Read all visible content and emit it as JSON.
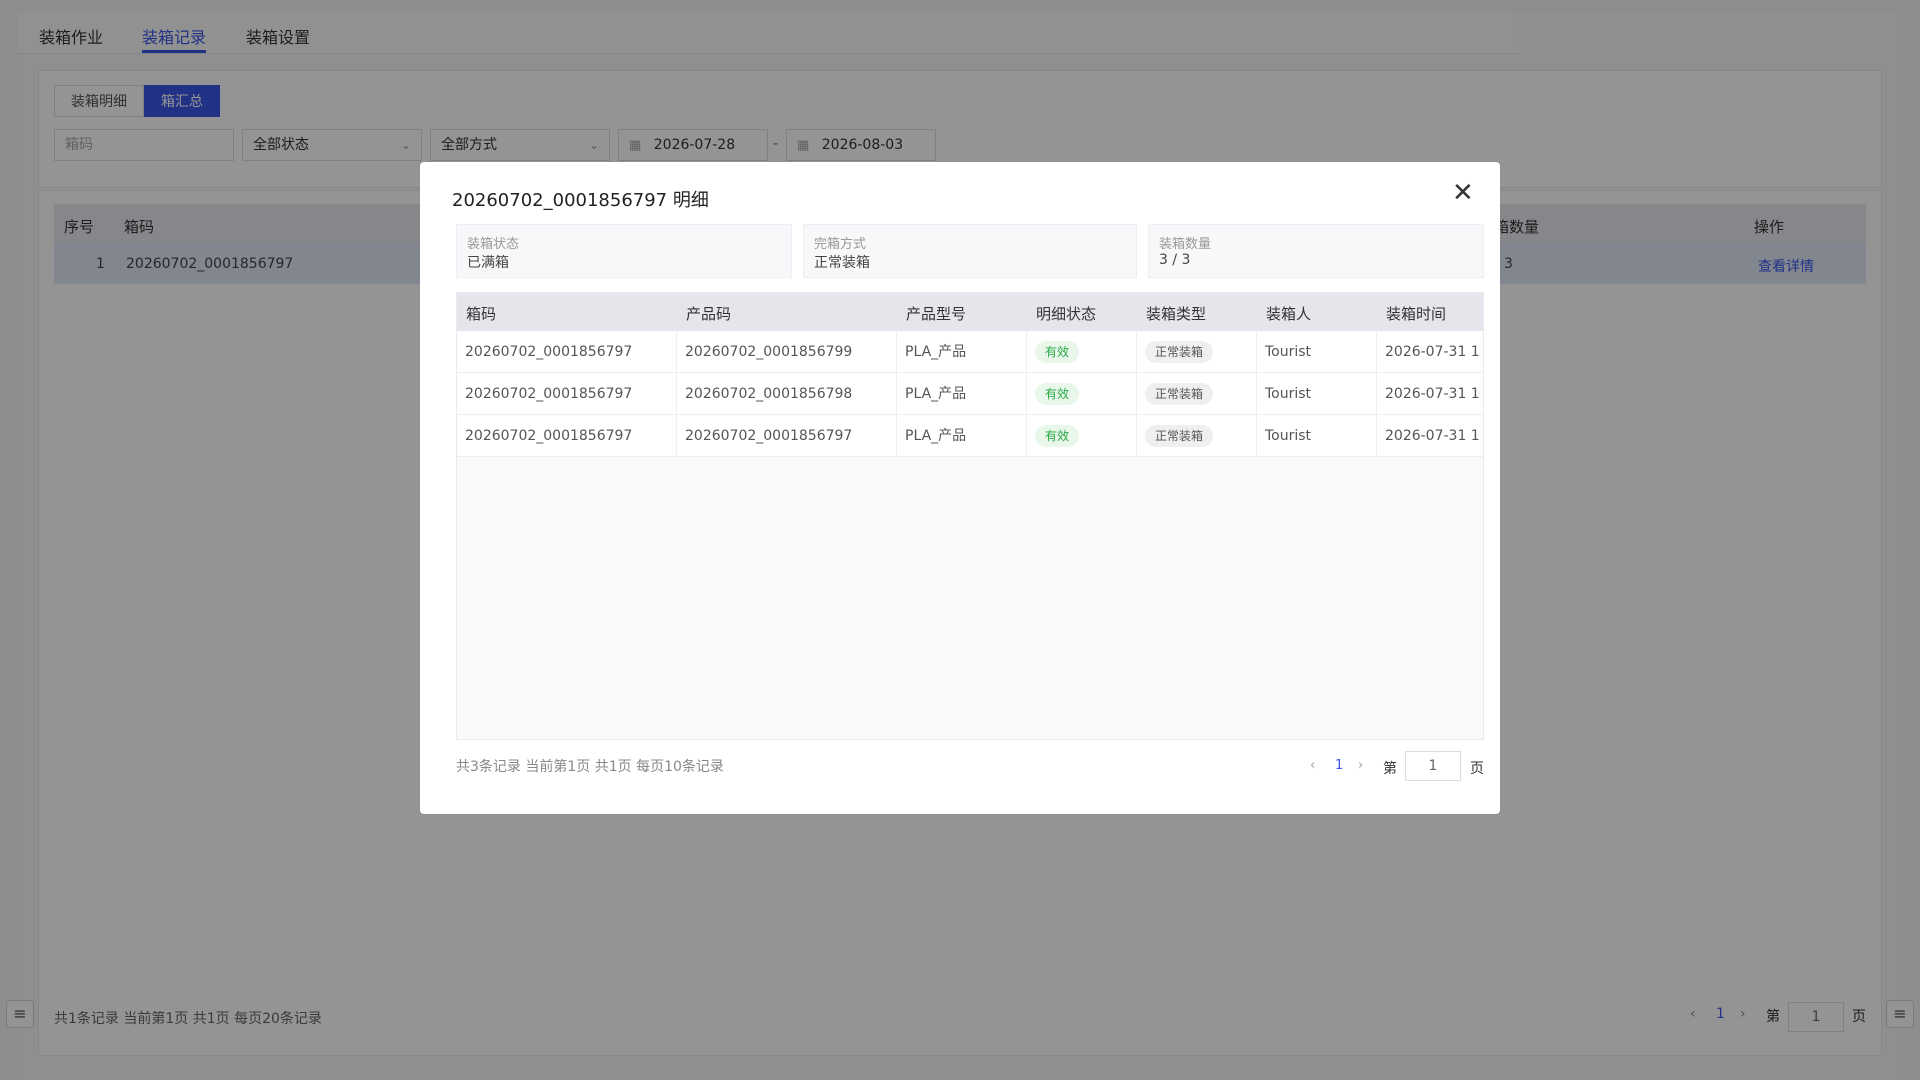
{
  "tabs": [
    {
      "label": "装箱作业"
    },
    {
      "label": "装箱记录"
    },
    {
      "label": "装箱设置"
    }
  ],
  "segments": [
    {
      "label": "装箱明细"
    },
    {
      "label": "箱汇总"
    }
  ],
  "filters": {
    "box_code_placeholder": "箱码",
    "status_value": "全部状态",
    "method_value": "全部方式",
    "date_start": "2026-07-28",
    "date_separator": "-",
    "date_end": "2026-08-03"
  },
  "list": {
    "headers": {
      "index": "序号",
      "box_code": "箱码",
      "qty": "箱数量",
      "action": "操作"
    },
    "row": {
      "index": "1",
      "box_code": "20260702_0001856797",
      "qty": "3",
      "action": "查看详情"
    },
    "footer": "共1条记录 当前第1页 共1页 每页20条记录",
    "pager": {
      "prev": "‹",
      "current": "1",
      "next": "›",
      "page_prefix": "第",
      "page_value": "1",
      "page_suffix": "页"
    }
  },
  "modal": {
    "title": "20260702_0001856797 明细",
    "info": [
      {
        "label": "装箱状态",
        "value": "已满箱"
      },
      {
        "label": "完箱方式",
        "value": "正常装箱"
      },
      {
        "label": "装箱数量",
        "value": "3 / 3"
      }
    ],
    "headers": [
      "箱码",
      "产品码",
      "产品型号",
      "明细状态",
      "装箱类型",
      "装箱人",
      "装箱时间"
    ],
    "rows": [
      {
        "box": "20260702_0001856797",
        "product": "20260702_0001856799",
        "model": "PLA_产品",
        "status": "有效",
        "type": "正常装箱",
        "user": "Tourist",
        "time": "2026-07-31 1"
      },
      {
        "box": "20260702_0001856797",
        "product": "20260702_0001856798",
        "model": "PLA_产品",
        "status": "有效",
        "type": "正常装箱",
        "user": "Tourist",
        "time": "2026-07-31 1"
      },
      {
        "box": "20260702_0001856797",
        "product": "20260702_0001856797",
        "model": "PLA_产品",
        "status": "有效",
        "type": "正常装箱",
        "user": "Tourist",
        "time": "2026-07-31 1"
      }
    ],
    "footer": "共3条记录 当前第1页 共1页 每页10条记录",
    "pager": {
      "prev": "‹",
      "current": "1",
      "next": "›",
      "page_prefix": "第",
      "page_value": "1",
      "page_suffix": "页"
    }
  },
  "colors": {
    "accent": "#3a55e6",
    "valid_tag": "#2aa745"
  }
}
